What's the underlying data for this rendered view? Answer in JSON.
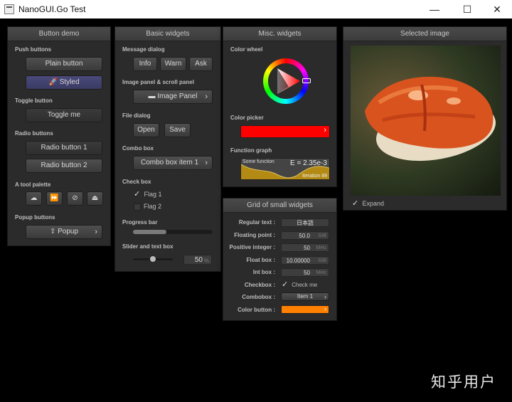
{
  "window": {
    "title": "NanoGUI.Go Test",
    "minimize": "—",
    "maximize": "☐",
    "close": "✕"
  },
  "button_demo": {
    "title": "Button demo",
    "push_label": "Push buttons",
    "plain": "Plain button",
    "styled": "Styled",
    "toggle_label": "Toggle button",
    "toggle": "Toggle me",
    "radio_label": "Radio buttons",
    "radio1": "Radio button 1",
    "radio2": "Radio button 2",
    "tool_label": "A tool palette",
    "popup_label": "Popup buttons",
    "popup": "Popup"
  },
  "basic": {
    "title": "Basic widgets",
    "msg_label": "Message dialog",
    "info": "Info",
    "warn": "Warn",
    "ask": "Ask",
    "image_label": "Image panel & scroll panel",
    "image_btn": "Image Panel",
    "file_label": "File dialog",
    "open": "Open",
    "save": "Save",
    "combo_label": "Combo box",
    "combo_value": "Combo box item 1",
    "check_label": "Check box",
    "flag1": "Flag 1",
    "flag2": "Flag 2",
    "progress_label": "Progress bar",
    "progress": 0.42,
    "slider_label": "Slider and text box",
    "slider_value": "50",
    "slider_unit": "%",
    "slider_fraction": 0.5
  },
  "misc": {
    "title": "Misc. widgets",
    "wheel_label": "Color wheel",
    "picker_label": "Color picker",
    "picker_color": "#ff0000",
    "graph_label": "Function graph",
    "graph_caption": "Some function",
    "graph_value": "E = 2.35e-3",
    "graph_footer": "Iteration 89"
  },
  "grid": {
    "title": "Grid of small widgets",
    "rows": [
      {
        "label": "Regular text :",
        "value": "日本語",
        "unit": ""
      },
      {
        "label": "Floating point :",
        "value": "50.0",
        "unit": "GiB"
      },
      {
        "label": "Positive integer :",
        "value": "50",
        "unit": "MHz"
      },
      {
        "label": "Float box :",
        "value": "10.00000",
        "unit": "GiB"
      },
      {
        "label": "Int box :",
        "value": "50",
        "unit": "MHz"
      }
    ],
    "checkbox_label": "Checkbox :",
    "checkbox_text": "Check me",
    "combobox_label": "Combobox :",
    "combobox_value": "Item 1",
    "colorbtn_label": "Color button :",
    "colorbtn_color": "#ff7f00"
  },
  "image": {
    "title": "Selected image",
    "expand": "Expand"
  },
  "watermark": "知乎用户"
}
